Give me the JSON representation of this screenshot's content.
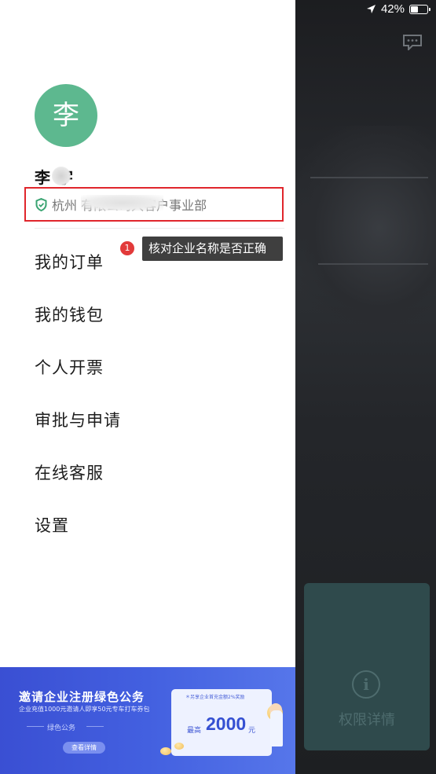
{
  "status_bar": {
    "battery_percent": "42%",
    "battery_level": 0.42
  },
  "user": {
    "avatar_char": "李",
    "name_visible": "李 宇",
    "company": "杭州 有限公司大客户事业部"
  },
  "tooltip": {
    "badge": "1",
    "text": "核对企业名称是否正确"
  },
  "menu": {
    "items": [
      "我的订单",
      "我的钱包",
      "个人开票",
      "审批与申请",
      "在线客服",
      "设置"
    ]
  },
  "banner": {
    "title": "邀请企业注册绿色公务",
    "subtitle": "企业充值1000元邀请人即享50元专车打车券包",
    "tag": "绿色公务",
    "button": "查看详情",
    "coupon_top": "＊另享企业首充金额2%奖励",
    "coupon_prefix": "最高",
    "coupon_amount": "2000",
    "coupon_unit": "元"
  },
  "right_panel": {
    "card_label": "权限详情"
  },
  "colors": {
    "avatar": "#5db88f",
    "highlight": "#e0262c",
    "banner": "#4360e0",
    "card": "#2f4a4c"
  }
}
